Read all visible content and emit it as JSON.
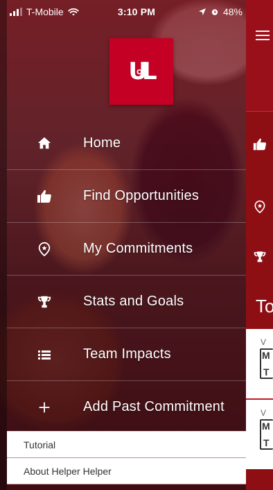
{
  "status_bar": {
    "carrier": "T-Mobile",
    "time": "3:10 PM",
    "battery": "48%"
  },
  "logo": {
    "text_u": "U",
    "text_of": "OF",
    "text_l": "L"
  },
  "menu": {
    "items": [
      {
        "label": "Home",
        "icon": "home-icon"
      },
      {
        "label": "Find Opportunities",
        "icon": "thumbs-up-icon"
      },
      {
        "label": "My Commitments",
        "icon": "location-star-icon"
      },
      {
        "label": "Stats and Goals",
        "icon": "trophy-icon"
      },
      {
        "label": "Team Impacts",
        "icon": "list-icon"
      },
      {
        "label": "Add Past Commitment",
        "icon": "plus-icon"
      }
    ]
  },
  "bottom_links": {
    "items": [
      {
        "label": "Tutorial"
      },
      {
        "label": "About Helper Helper"
      }
    ]
  },
  "peek": {
    "to_text": "To",
    "cards": [
      {
        "top_text": "V",
        "mid_text": "M",
        "bottom_text": "T"
      },
      {
        "top_text": "V",
        "mid_text": "M",
        "bottom_text": "T"
      }
    ]
  },
  "colors": {
    "brand_red": "#c40024",
    "peek_red": "#8d0f14",
    "divider": "#a02832"
  }
}
